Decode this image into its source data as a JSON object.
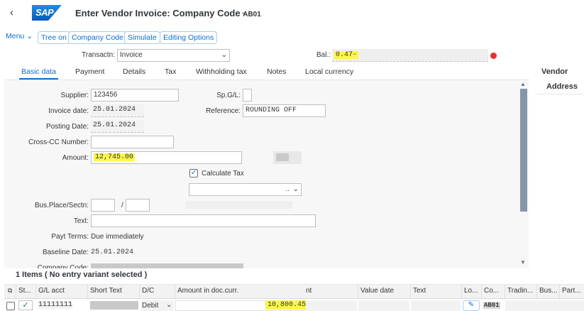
{
  "header": {
    "title": "Enter Vendor Invoice: Company Code",
    "company_code": "AB01",
    "logo_text": "SAP",
    "back_glyph": "‹",
    "chevron_glyph": "⌄"
  },
  "toolbar": {
    "menu_label": "Menu",
    "menu_chevron": "⌄",
    "buttons": [
      "Tree on",
      "Company Code",
      "Simulate",
      "Editing Options"
    ]
  },
  "transaction": {
    "label": "Transactn:",
    "value": "Invoice",
    "balance_label": "Bal.:",
    "balance_value": "0.47-",
    "status_color": "#e9302f"
  },
  "tabs": [
    "Basic data",
    "Payment",
    "Details",
    "Tax",
    "Withholding tax",
    "Notes",
    "Local currency"
  ],
  "side": {
    "vendor": "Vendor",
    "address": "Address"
  },
  "form": {
    "supplier_label": "Supplier:",
    "supplier_value": "123456",
    "spgli_label": "Sp.G/L:",
    "invoice_date_label": "Invoice date:",
    "invoice_date_value": "25.01.2024",
    "reference_label": "Reference:",
    "reference_value": "ROUNDING OFF",
    "posting_date_label": "Posting Date:",
    "posting_date_value": "25.01.2024",
    "crosscc_label": "Cross-CC Number:",
    "amount_label": "Amount:",
    "amount_value": "12,745.00",
    "calc_tax_label": "Calculate Tax",
    "calc_tax_checked": true,
    "tax_dd_value": "..",
    "busplace_label": "Bus.Place/Sectn:",
    "busplace_sep": "/",
    "text_label": "Text:",
    "payt_terms_label": "Payt Terms:",
    "payt_terms_value": "Due immediately",
    "baseline_label": "Baseline Date:",
    "baseline_value": "25.01.2024",
    "company_code_label": "Company Code:"
  },
  "items": {
    "title": "1 Items ( No entry variant selected )",
    "columns": [
      "St...",
      "G/L acct",
      "Short Text",
      "D/C",
      "Amount in doc.curr.",
      "nt",
      "Value date",
      "Text",
      "Lo...",
      "Co...",
      "Tradin...",
      "Bus...",
      "Part..."
    ],
    "row": {
      "gl_acct": "11111111",
      "dc": "Debit",
      "amount": "10,800.45",
      "company_code": "AB01"
    }
  }
}
